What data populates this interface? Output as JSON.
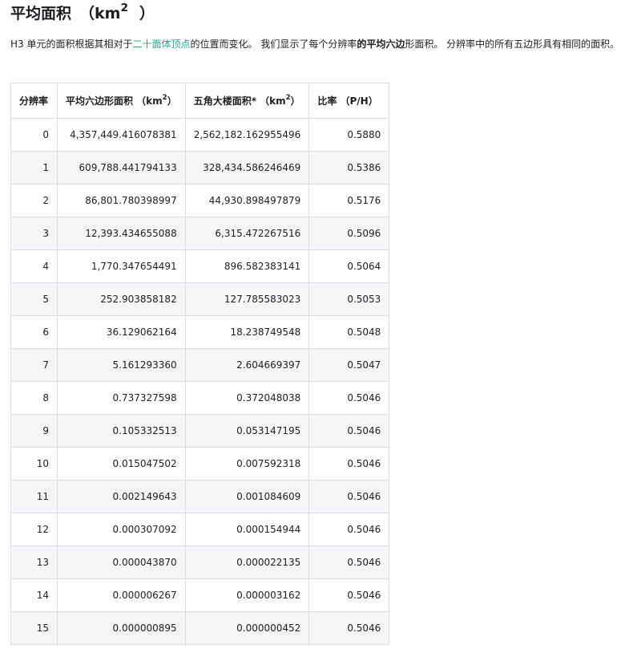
{
  "heading": {
    "text": "平均面积",
    "unit_open": "（km",
    "unit_exp": "2",
    "unit_close": "）"
  },
  "intro": {
    "part1": "H3 单元的面积根据其相对于",
    "link": "二十面体顶点",
    "part2": "的位置而变化。 我们显示了每个分辨率",
    "bold": "的平均六边",
    "part3": "形面积。 分辨率中的所有五边形具有相同的面积。"
  },
  "table": {
    "headers": {
      "resolution": "分辨率",
      "hex_pre": "平均六边形面积 （km",
      "hex_exp": "2",
      "hex_post": "）",
      "pent_pre": "五角大楼面积* （km",
      "pent_exp": "2",
      "pent_post": "）",
      "ratio": "比率 （P/H）"
    },
    "rows": [
      {
        "res": "0",
        "hex": "4,357,449.416078381",
        "pent": "2,562,182.162955496",
        "ratio": "0.5880"
      },
      {
        "res": "1",
        "hex": "609,788.441794133",
        "pent": "328,434.586246469",
        "ratio": "0.5386"
      },
      {
        "res": "2",
        "hex": "86,801.780398997",
        "pent": "44,930.898497879",
        "ratio": "0.5176"
      },
      {
        "res": "3",
        "hex": "12,393.434655088",
        "pent": "6,315.472267516",
        "ratio": "0.5096"
      },
      {
        "res": "4",
        "hex": "1,770.347654491",
        "pent": "896.582383141",
        "ratio": "0.5064"
      },
      {
        "res": "5",
        "hex": "252.903858182",
        "pent": "127.785583023",
        "ratio": "0.5053"
      },
      {
        "res": "6",
        "hex": "36.129062164",
        "pent": "18.238749548",
        "ratio": "0.5048"
      },
      {
        "res": "7",
        "hex": "5.161293360",
        "pent": "2.604669397",
        "ratio": "0.5047"
      },
      {
        "res": "8",
        "hex": "0.737327598",
        "pent": "0.372048038",
        "ratio": "0.5046"
      },
      {
        "res": "9",
        "hex": "0.105332513",
        "pent": "0.053147195",
        "ratio": "0.5046"
      },
      {
        "res": "10",
        "hex": "0.015047502",
        "pent": "0.007592318",
        "ratio": "0.5046"
      },
      {
        "res": "11",
        "hex": "0.002149643",
        "pent": "0.001084609",
        "ratio": "0.5046"
      },
      {
        "res": "12",
        "hex": "0.000307092",
        "pent": "0.000154944",
        "ratio": "0.5046"
      },
      {
        "res": "13",
        "hex": "0.000043870",
        "pent": "0.000022135",
        "ratio": "0.5046"
      },
      {
        "res": "14",
        "hex": "0.000006267",
        "pent": "0.000003162",
        "ratio": "0.5046"
      },
      {
        "res": "15",
        "hex": "0.000000895",
        "pent": "0.000000452",
        "ratio": "0.5046"
      }
    ]
  },
  "colors": {
    "link": "#25a891",
    "border": "#dadde1",
    "stripe": "#f5f6f7"
  }
}
